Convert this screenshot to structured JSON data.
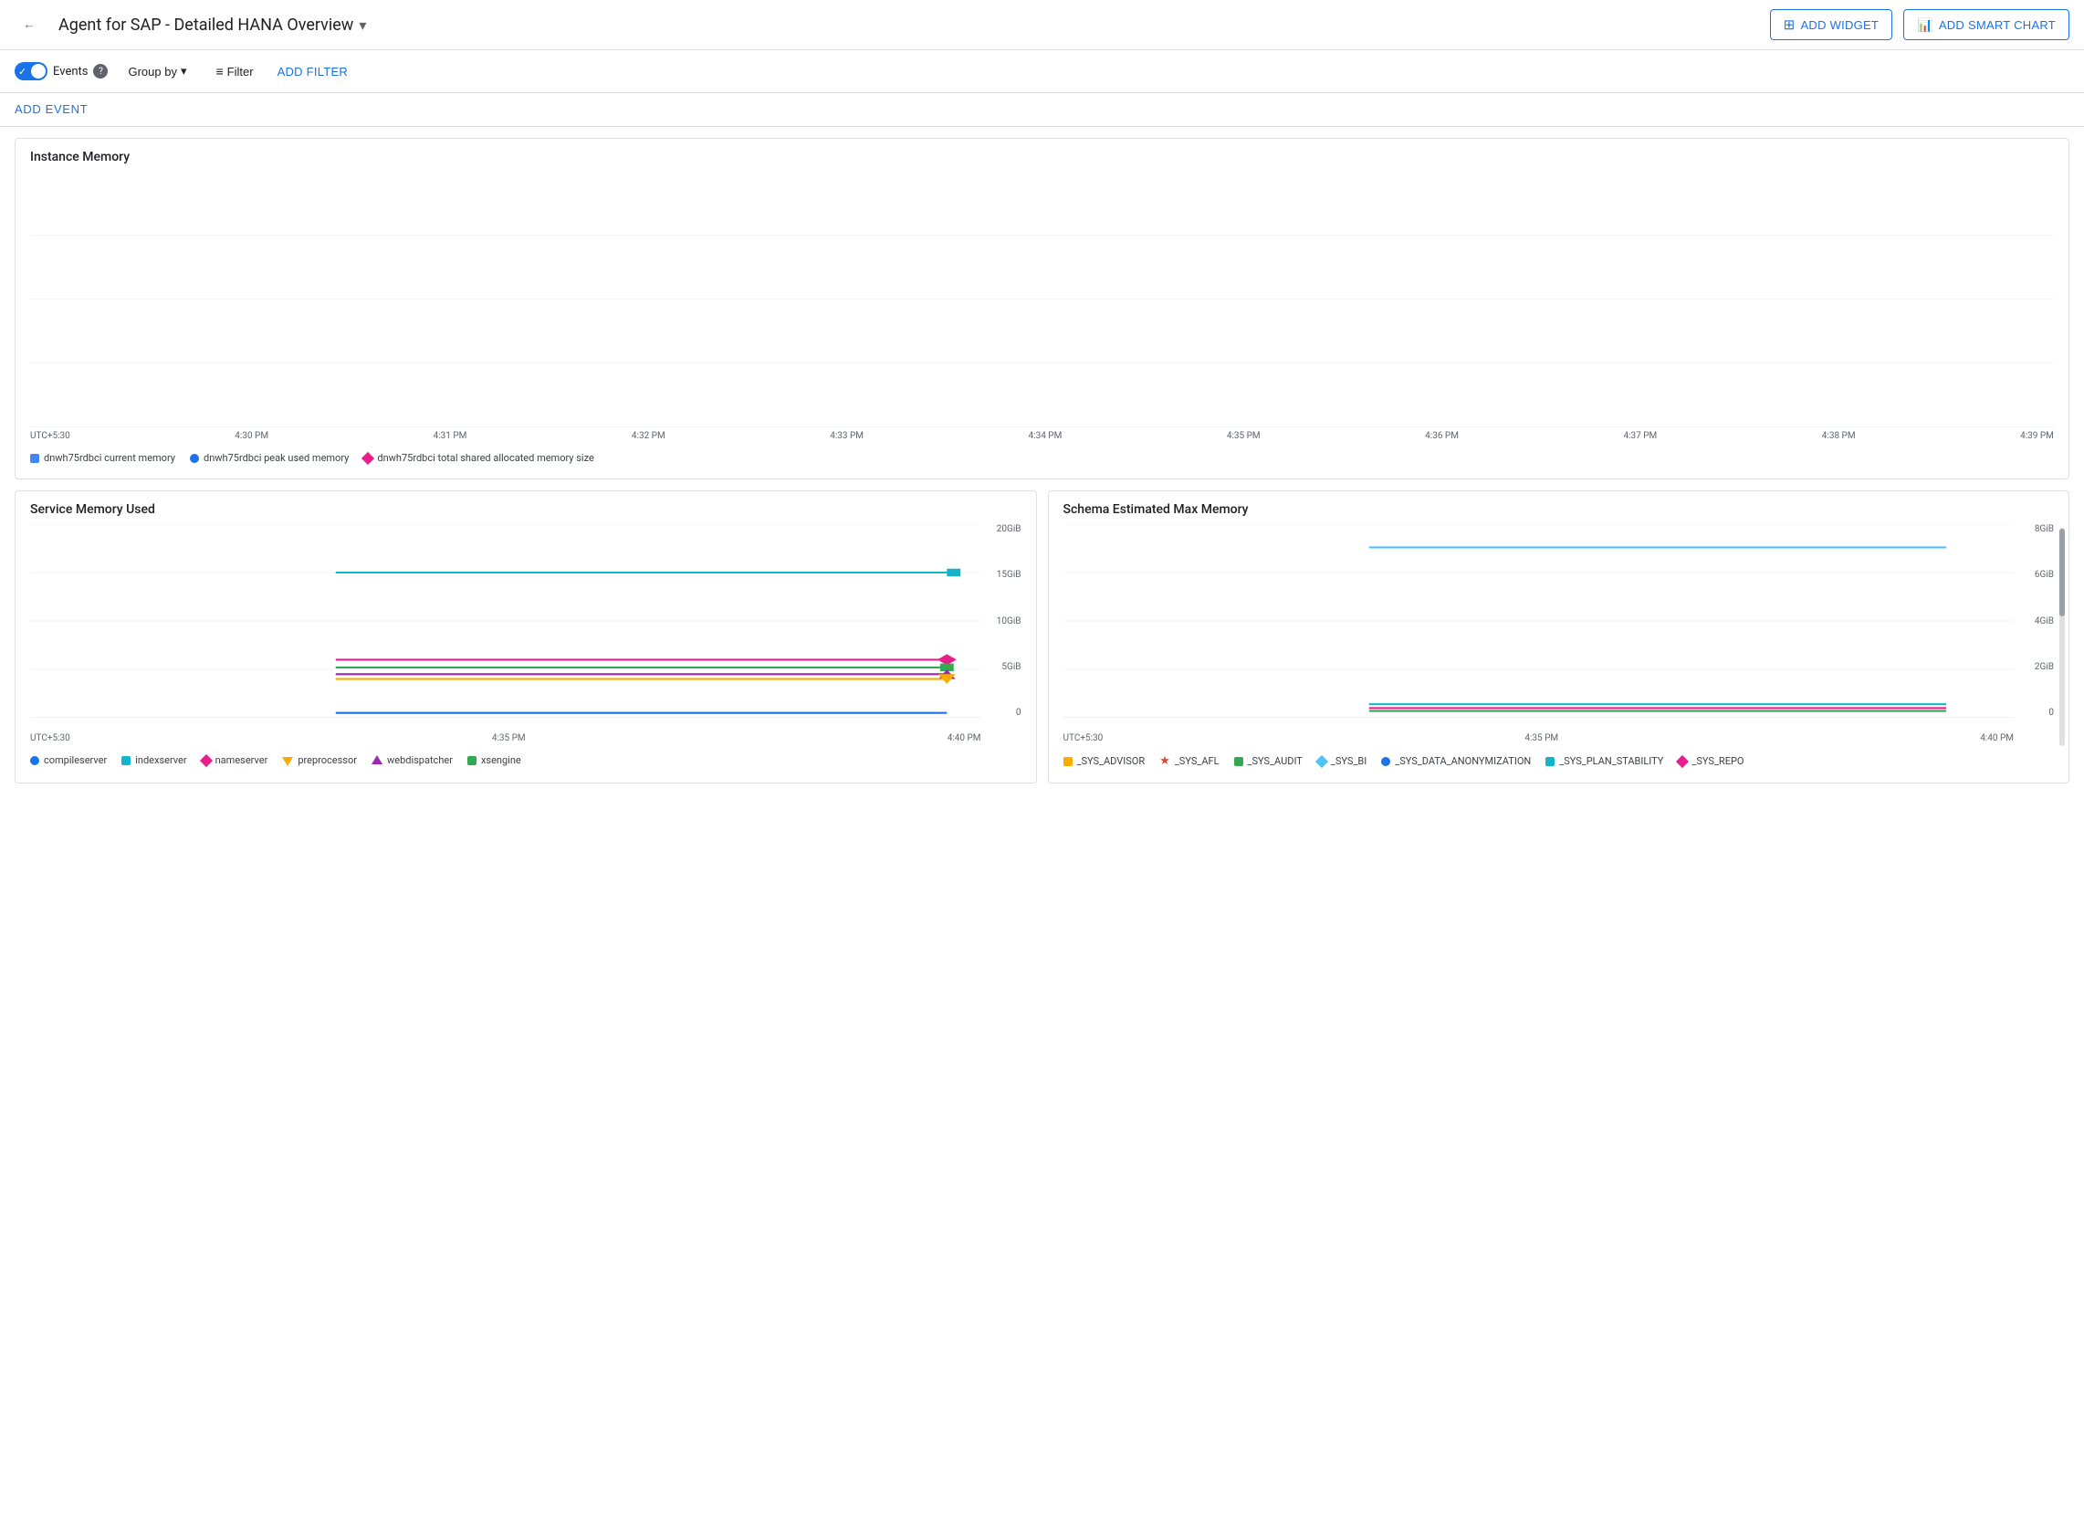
{
  "header": {
    "back_label": "←",
    "title": "Agent for SAP - Detailed HANA Overview",
    "dropdown_arrow": "▾",
    "add_widget_label": "ADD WIDGET",
    "add_smart_chart_label": "ADD SMART CHART"
  },
  "toolbar": {
    "events_label": "Events",
    "group_by_label": "Group by",
    "filter_label": "Filter",
    "add_filter_label": "ADD FILTER"
  },
  "add_event": {
    "label": "ADD EVENT"
  },
  "instance_memory": {
    "title": "Instance Memory",
    "time_labels": [
      "UTC+5:30",
      "4:30 PM",
      "4:31 PM",
      "4:32 PM",
      "4:33 PM",
      "4:34 PM",
      "4:35 PM",
      "4:36 PM",
      "4:37 PM",
      "4:38 PM",
      "4:39 PM"
    ],
    "legend": [
      {
        "label": "dnwh75rdbci current memory",
        "type": "square",
        "color": "#4285f4"
      },
      {
        "label": "dnwh75rdbci peak used memory",
        "type": "circle",
        "color": "#1a73e8"
      },
      {
        "label": "dnwh75rdbci total shared allocated memory size",
        "type": "diamond",
        "color": "#e91e8c"
      }
    ]
  },
  "service_memory": {
    "title": "Service Memory Used",
    "y_labels": [
      "20GiB",
      "15GiB",
      "10GiB",
      "5GiB",
      "0"
    ],
    "time_labels": [
      "UTC+5:30",
      "4:35 PM",
      "4:40 PM"
    ],
    "legend": [
      {
        "label": "compileserver",
        "type": "circle",
        "color": "#1a73e8"
      },
      {
        "label": "indexserver",
        "type": "square",
        "color": "#12b5cb"
      },
      {
        "label": "nameserver",
        "type": "diamond",
        "color": "#e91e8c"
      },
      {
        "label": "preprocessor",
        "type": "triangle-down",
        "color": "#f9ab00"
      },
      {
        "label": "webdispatcher",
        "type": "triangle-up",
        "color": "#9c27b0"
      },
      {
        "label": "xsengine",
        "type": "square",
        "color": "#34a853"
      }
    ],
    "lines": [
      {
        "color": "#12b5cb",
        "y_pct": 20,
        "label": "15GiB"
      },
      {
        "color": "#e91e8c",
        "y_pct": 57,
        "label": "5GiB"
      },
      {
        "color": "#34a853",
        "y_pct": 60,
        "label": ""
      },
      {
        "color": "#9c27b0",
        "y_pct": 62,
        "label": ""
      },
      {
        "color": "#f9ab00",
        "y_pct": 63,
        "label": ""
      },
      {
        "color": "#1a73e8",
        "y_pct": 65,
        "label": "0"
      }
    ]
  },
  "schema_memory": {
    "title": "Schema Estimated Max Memory",
    "y_labels": [
      "8GiB",
      "6GiB",
      "4GiB",
      "2GiB",
      "0"
    ],
    "time_labels": [
      "UTC+5:30",
      "4:35 PM",
      "4:40 PM"
    ],
    "legend": [
      {
        "label": "_SYS_ADVISOR",
        "type": "square",
        "color": "#f9ab00"
      },
      {
        "label": "_SYS_AFL",
        "type": "star",
        "color": "#ea4335"
      },
      {
        "label": "_SYS_AUDIT",
        "type": "square",
        "color": "#34a853"
      },
      {
        "label": "_SYS_BI",
        "type": "diamond",
        "color": "#4fc3f7"
      },
      {
        "label": "_SYS_DATA_ANONYMIZATION",
        "type": "circle",
        "color": "#1a73e8"
      },
      {
        "label": "_SYS_PLAN_STABILITY",
        "type": "square",
        "color": "#12b5cb"
      },
      {
        "label": "_SYS_REPO",
        "type": "diamond",
        "color": "#e91e8c"
      }
    ],
    "lines": [
      {
        "color": "#12b5cb",
        "y_pct": 12,
        "label": ""
      },
      {
        "color": "#e91e8c",
        "y_pct": 72,
        "label": ""
      },
      {
        "color": "#34a853",
        "y_pct": 74,
        "label": "0"
      }
    ]
  },
  "colors": {
    "primary": "#1a73e8",
    "border": "#e0e0e0",
    "grid": "#f1f3f4",
    "text_secondary": "#5f6368"
  }
}
